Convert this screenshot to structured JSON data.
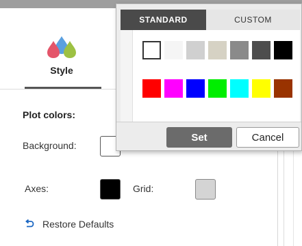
{
  "style_tab": {
    "label": "Style",
    "icon": "color-drops-icon"
  },
  "plot_colors": {
    "title": "Plot colors:",
    "background_label": "Background:",
    "axes_label": "Axes:",
    "grid_label": "Grid:",
    "background_color": "#ffffff",
    "axes_color": "#000000",
    "grid_color": "#d4d4d4"
  },
  "restore": {
    "label": "Restore Defaults",
    "icon": "undo-arrow-icon"
  },
  "picker": {
    "tabs": [
      {
        "label": "STANDARD",
        "active": true
      },
      {
        "label": "CUSTOM",
        "active": false
      }
    ],
    "row1": [
      "#ffffff",
      "#f5f5f5",
      "#d0d0d0",
      "#d6d2c4",
      "#8a8a8a",
      "#4d4d4d",
      "#000000"
    ],
    "row2": [
      "#ff0000",
      "#ff00ff",
      "#0000ff",
      "#00ee00",
      "#00ffff",
      "#ffff00",
      "#993300"
    ],
    "selected": "#ffffff",
    "set_label": "Set",
    "cancel_label": "Cancel"
  },
  "colors": {
    "accent_dark": "#4a4a4a",
    "set_button": "#6b6b6b"
  }
}
